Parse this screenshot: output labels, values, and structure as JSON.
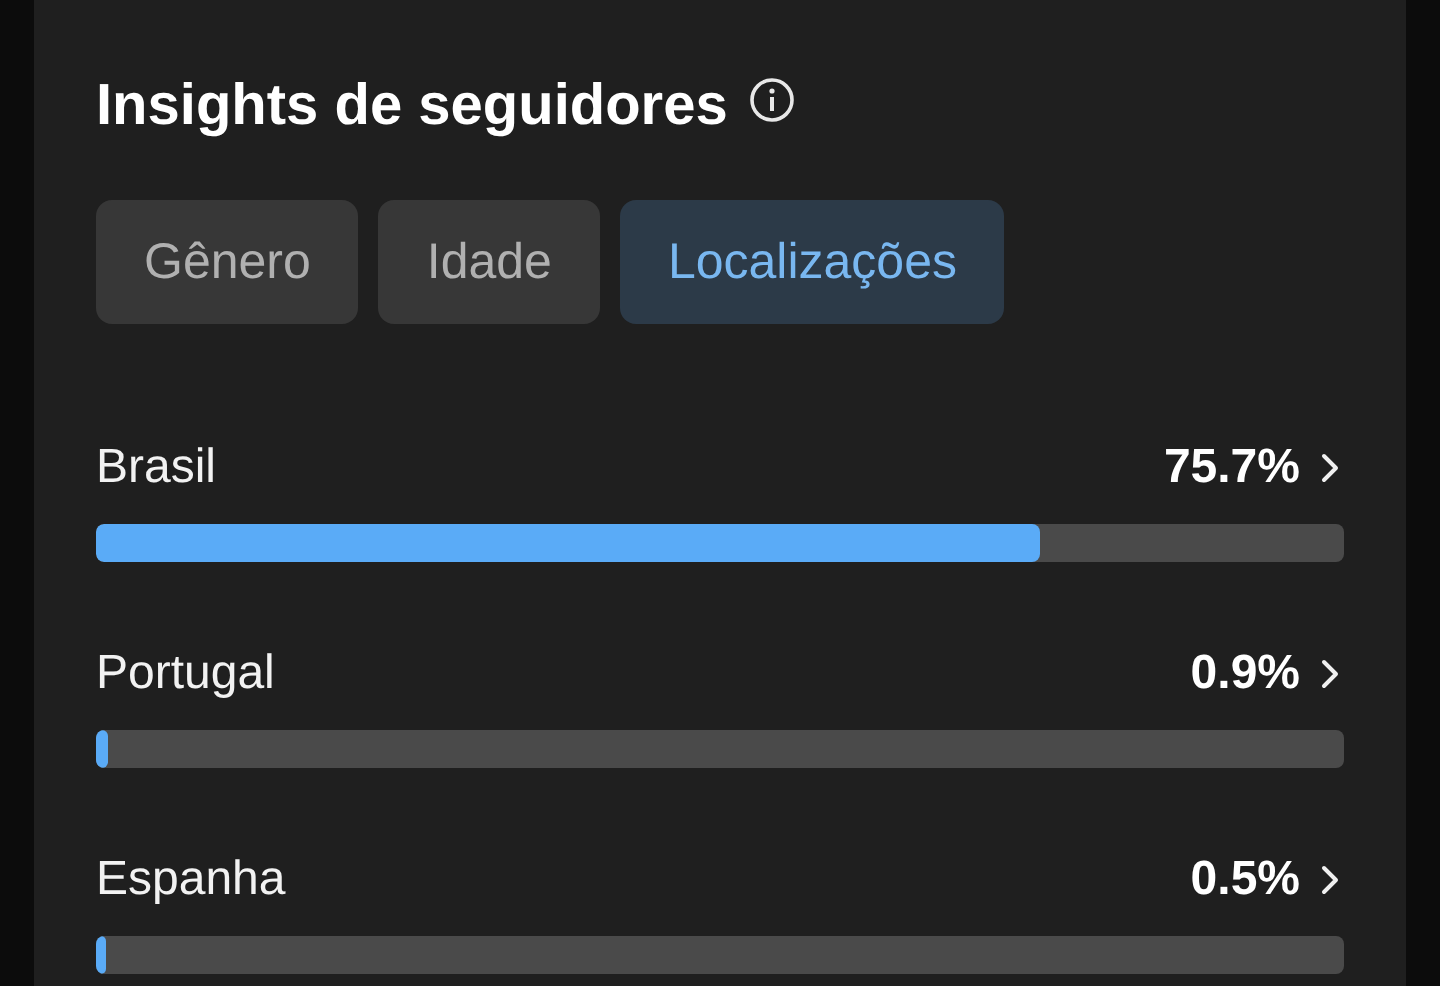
{
  "title": "Insights de seguidores",
  "tabs": [
    {
      "label": "Gênero",
      "selected": false
    },
    {
      "label": "Idade",
      "selected": false
    },
    {
      "label": "Localizações",
      "selected": true
    }
  ],
  "locations": [
    {
      "name": "Brasil",
      "value": "75.7%",
      "level": 0.757
    },
    {
      "name": "Portugal",
      "value": "0.9%",
      "level": 0.009
    },
    {
      "name": "Espanha",
      "value": "0.5%",
      "level": 0.005
    }
  ]
}
